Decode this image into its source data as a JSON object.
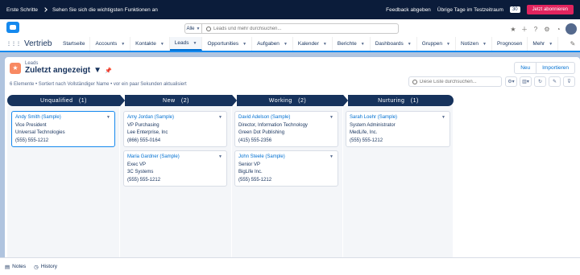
{
  "topbar": {
    "steps": "Erste Schritte",
    "hint": "Sehen Sie sich die wichtigsten Funktionen an",
    "feedback": "Feedback abgeben",
    "trial_label": "Übrige Tage im Testzeitraum",
    "trial_days": "30",
    "subscribe": "Jetzt abonnieren"
  },
  "search": {
    "scope": "Alle",
    "placeholder": "Leads und mehr durchsuchen..."
  },
  "nav": {
    "app_name": "Vertrieb",
    "items": [
      {
        "label": "Startseite",
        "dropdown": false
      },
      {
        "label": "Accounts",
        "dropdown": true
      },
      {
        "label": "Kontakte",
        "dropdown": true
      },
      {
        "label": "Leads",
        "dropdown": true,
        "active": true
      },
      {
        "label": "Opportunities",
        "dropdown": true
      },
      {
        "label": "Aufgaben",
        "dropdown": true
      },
      {
        "label": "Kalender",
        "dropdown": true
      },
      {
        "label": "Berichte",
        "dropdown": true
      },
      {
        "label": "Dashboards",
        "dropdown": true
      },
      {
        "label": "Gruppen",
        "dropdown": true
      },
      {
        "label": "Notizen",
        "dropdown": true
      },
      {
        "label": "Prognosen",
        "dropdown": false
      },
      {
        "label": "Mehr",
        "dropdown": true
      }
    ]
  },
  "list": {
    "object": "Leads",
    "view": "Zuletzt angezeigt",
    "meta": "6 Elemente • Sortiert nach Vollständiger Name • vor ein paar Sekunden aktualisiert",
    "search_placeholder": "Diese Liste durchsuchen...",
    "new_button": "Neu",
    "import_button": "Importieren"
  },
  "stages": [
    {
      "name": "Unqualified",
      "count": "(1)"
    },
    {
      "name": "New",
      "count": "(2)"
    },
    {
      "name": "Working",
      "count": "(2)"
    },
    {
      "name": "Nurturing",
      "count": "(1)"
    }
  ],
  "cards": [
    {
      "name": "Andy Smith (Sample)",
      "title": "Vice President",
      "company": "Universal Technologies",
      "phone": "(555) 555-1212"
    },
    {
      "name": "Amy Jordan (Sample)",
      "title": "VP Purchasing",
      "company": "Lee Enterprise, Inc",
      "phone": "(866) 555-0164"
    },
    {
      "name": "Maria Gardner (Sample)",
      "title": "Exec VP",
      "company": "3C Systems",
      "phone": "(555) 555-1212"
    },
    {
      "name": "David Adelson (Sample)",
      "title": "Director, Information Technology",
      "company": "Green Dot Publishing",
      "phone": "(415) 555-2356"
    },
    {
      "name": "John Steele (Sample)",
      "title": "Senior VP",
      "company": "BigLife Inc.",
      "phone": "(555) 555-1212"
    },
    {
      "name": "Sarah Loehr (Sample)",
      "title": "System Administrator",
      "company": "MedLife, Inc.",
      "phone": "(555) 555-1212"
    }
  ],
  "footer": {
    "notes": "Notes",
    "history": "History"
  },
  "colors": {
    "accent": "#0070d2",
    "navy": "#16325c",
    "lead_icon": "#f88962",
    "subscribe": "#e0245e"
  }
}
